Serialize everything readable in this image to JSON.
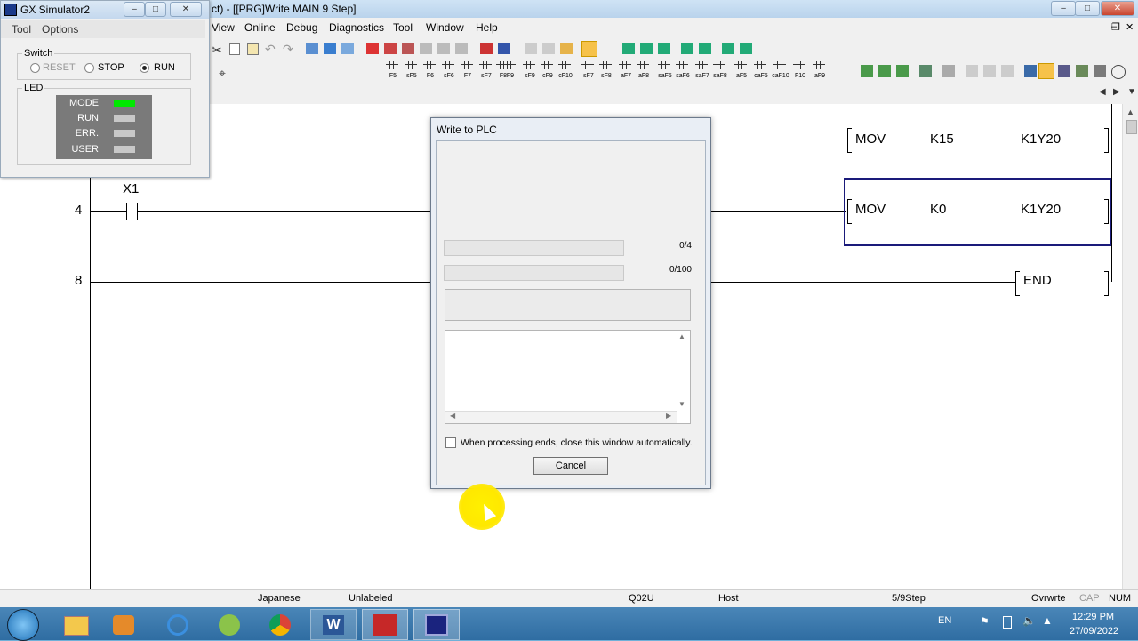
{
  "main_window": {
    "title": "ct) - [[PRG]Write MAIN 9 Step]",
    "menus": [
      "View",
      "Online",
      "Debug",
      "Diagnostics",
      "Tool",
      "Window",
      "Help"
    ],
    "toolbar_fkeys": [
      "F5",
      "sF5",
      "F6",
      "sF6",
      "F7",
      "sF7",
      "F8",
      "F9",
      "sF9",
      "cF9",
      "cF10",
      "sF7",
      "sF8",
      "aF7",
      "aF8",
      "saF5",
      "saF6",
      "saF7",
      "saF8",
      "aF5",
      "caF5",
      "caF10",
      "F10",
      "aF9"
    ]
  },
  "simulator": {
    "title": "GX Simulator2",
    "menus": [
      "Tool",
      "Options"
    ],
    "switch_title": "Switch",
    "switch_options": [
      "RESET",
      "STOP",
      "RUN"
    ],
    "switch_selected": "RUN",
    "led_title": "LED",
    "leds": [
      {
        "label": "MODE",
        "state": "on",
        "color": "#00e800"
      },
      {
        "label": "RUN",
        "state": "off"
      },
      {
        "label": "ERR.",
        "state": "off"
      },
      {
        "label": "USER",
        "state": "off"
      }
    ]
  },
  "ladder": {
    "step_numbers": [
      "4",
      "8"
    ],
    "contact_label": "X1",
    "instructions": [
      {
        "op": "MOV",
        "src": "K15",
        "dst": "K1Y20"
      },
      {
        "op": "MOV",
        "src": "K0",
        "dst": "K1Y20"
      },
      {
        "op": "END"
      }
    ]
  },
  "dialog": {
    "title": "Write to PLC",
    "progress1": "0/4",
    "progress2": "0/100",
    "checkbox_label": "When processing ends, close this window automatically.",
    "checkbox_checked": false,
    "cancel_label": "Cancel"
  },
  "statusbar": {
    "language": "Japanese",
    "label_mode": "Unlabeled",
    "cpu": "Q02U",
    "connection": "Host",
    "step": "5/9Step",
    "mode": "Ovrwrte",
    "cap": "CAP",
    "num": "NUM"
  },
  "taskbar": {
    "lang": "EN",
    "time": "12:29 PM",
    "date": "27/09/2022"
  }
}
